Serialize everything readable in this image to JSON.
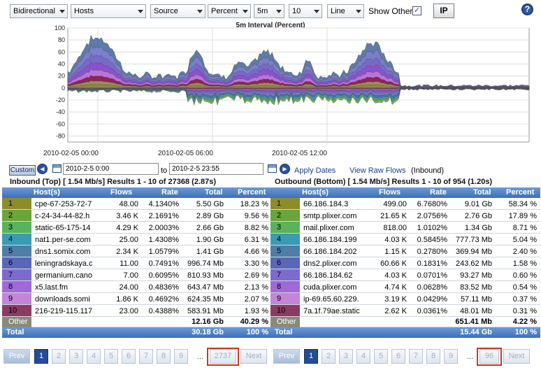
{
  "toolbar": {
    "direction": "Bidirectional",
    "metric": "Hosts",
    "source": "Source",
    "unit": "Percent",
    "interval": "5m",
    "count": "10",
    "chart_style": "Line",
    "show_other_label": "Show Other",
    "show_other_checked": "✓",
    "ip_button": "IP",
    "help": "?"
  },
  "chart_data": {
    "type": "area",
    "title": "5m Interval (Percent)",
    "y_ticks": [
      "100",
      "80",
      "60",
      "40",
      "20",
      "0",
      "-20",
      "-40",
      "-60",
      "-80"
    ],
    "ylim": [
      -90,
      100
    ],
    "x_ticks": [
      "2010-02-05 00:00",
      "2010-02-05 06:00",
      "2010-02-05 12:00"
    ],
    "series_colors": [
      "#8c8c2a",
      "#6aa43a",
      "#3b9bb3",
      "#4e6e9e",
      "#7f7fcf",
      "#7868c8",
      "#8e4fcf",
      "#c078d8",
      "#8b1c4a",
      "#9a9a60"
    ]
  },
  "dates": {
    "custom": "Custom",
    "start": "2010-2-5 0:00",
    "to": "to",
    "end": "2010-2-5 23:55",
    "apply": "Apply Dates",
    "raw": "View Raw Flows",
    "raw_suffix": "(Inbound)"
  },
  "inbound": {
    "header": "Inbound (Top) [ 1.54 Mb/s] Results 1 - 10 of 27368 (2.87s)",
    "columns": [
      "Host(s)",
      "Flows",
      "Rate",
      "Total",
      "Percent"
    ],
    "rows": [
      {
        "n": "1",
        "host": "cpe-67-253-72-7",
        "flows": "48.00",
        "rate": "4.1340%",
        "total": "5.50 Gb",
        "pct": "18.23 %",
        "color": "#8c8c2a"
      },
      {
        "n": "2",
        "host": "c-24-34-44-82.h",
        "flows": "3.46 K",
        "rate": "2.1691%",
        "total": "2.89 Gb",
        "pct": "9.56 %",
        "color": "#6aa43a"
      },
      {
        "n": "3",
        "host": "static-65-175-14",
        "flows": "4.29 K",
        "rate": "2.0003%",
        "total": "2.66 Gb",
        "pct": "8.82 %",
        "color": "#5ab25a"
      },
      {
        "n": "4",
        "host": "nat1.per-se.com",
        "flows": "25.00",
        "rate": "1.4308%",
        "total": "1.90 Gb",
        "pct": "6.31 %",
        "color": "#3b9bb3"
      },
      {
        "n": "5",
        "host": "dns1.somix.com",
        "flows": "2.34 K",
        "rate": "1.0579%",
        "total": "1.41 Gb",
        "pct": "4.66 %",
        "color": "#4e7ea8"
      },
      {
        "n": "6",
        "host": "leningradskaya.c",
        "flows": "11.00",
        "rate": "0.7491%",
        "total": "996.74 Mb",
        "pct": "3.30 %",
        "color": "#5a66b8"
      },
      {
        "n": "7",
        "host": "germanium.cano",
        "flows": "7.00",
        "rate": "0.6095%",
        "total": "810.93 Mb",
        "pct": "2.69 %",
        "color": "#7d6ad0"
      },
      {
        "n": "8",
        "host": "x5.last.fm",
        "flows": "24.00",
        "rate": "0.4836%",
        "total": "643.47 Mb",
        "pct": "2.13 %",
        "color": "#a068d8"
      },
      {
        "n": "9",
        "host": "downloads.somi",
        "flows": "1.86 K",
        "rate": "0.4692%",
        "total": "624.35 Mb",
        "pct": "2.07 %",
        "color": "#c484d8"
      },
      {
        "n": "10",
        "host": "216-219-115.117",
        "flows": "23.00",
        "rate": "0.4388%",
        "total": "583.91 Mb",
        "pct": "1.93 %",
        "color": "#8b3a62"
      }
    ],
    "other": {
      "label": "Other",
      "total": "12.16 Gb",
      "pct": "40.29 %"
    },
    "total": {
      "label": "Total",
      "total": "30.18 Gb",
      "pct": "100 %"
    }
  },
  "outbound": {
    "header": "Outbound (Bottom) [ 1.54 Mb/s] Results 1 - 10 of 954 (1.20s)",
    "columns": [
      "Host(s)",
      "Flows",
      "Rate",
      "Total",
      "Percent"
    ],
    "rows": [
      {
        "n": "1",
        "host": "66.186.184.3",
        "flows": "499.00",
        "rate": "6.7680%",
        "total": "9.01 Gb",
        "pct": "58.34 %",
        "color": "#8c8c2a"
      },
      {
        "n": "2",
        "host": "smtp.plixer.com",
        "flows": "21.65 K",
        "rate": "2.0756%",
        "total": "2.76 Gb",
        "pct": "17.89 %",
        "color": "#6aa43a"
      },
      {
        "n": "3",
        "host": "mail.plixer.com",
        "flows": "818.00",
        "rate": "1.0102%",
        "total": "1.34 Gb",
        "pct": "8.71 %",
        "color": "#5ab25a"
      },
      {
        "n": "4",
        "host": "66.186.184.199",
        "flows": "4.03 K",
        "rate": "0.5845%",
        "total": "777.73 Mb",
        "pct": "5.04 %",
        "color": "#3b9bb3"
      },
      {
        "n": "5",
        "host": "66.186.184.202",
        "flows": "1.15 K",
        "rate": "0.2780%",
        "total": "369.94 Mb",
        "pct": "2.40 %",
        "color": "#4e7ea8"
      },
      {
        "n": "6",
        "host": "dns2.plixer.com",
        "flows": "60.66 K",
        "rate": "0.1831%",
        "total": "243.62 Mb",
        "pct": "1.58 %",
        "color": "#5a66b8"
      },
      {
        "n": "7",
        "host": "66.186.184.62",
        "flows": "4.03 K",
        "rate": "0.0701%",
        "total": "93.27 Mb",
        "pct": "0.60 %",
        "color": "#7d6ad0"
      },
      {
        "n": "8",
        "host": "cuda.plixer.com",
        "flows": "4.74 K",
        "rate": "0.0628%",
        "total": "83.52 Mb",
        "pct": "0.54 %",
        "color": "#a068d8"
      },
      {
        "n": "9",
        "host": "ip-69.65.60.229.",
        "flows": "3.19 K",
        "rate": "0.0429%",
        "total": "57.11 Mb",
        "pct": "0.37 %",
        "color": "#c484d8"
      },
      {
        "n": "10",
        "host": "7a.1f.79ae.static",
        "flows": "2.62 K",
        "rate": "0.0361%",
        "total": "48.01 Mb",
        "pct": "0.31 %",
        "color": "#8b3a62"
      }
    ],
    "other": {
      "label": "Other",
      "total": "651.41 Mb",
      "pct": "4.22 %"
    },
    "total": {
      "label": "Total",
      "total": "15.44 Gb",
      "pct": "100 %"
    }
  },
  "pager_left": {
    "prev": "Prev",
    "pages": [
      "1",
      "2",
      "3",
      "4",
      "5",
      "6",
      "7",
      "8",
      "9"
    ],
    "dots": "...",
    "last": "2737",
    "next": "Next"
  },
  "pager_right": {
    "prev": "Prev",
    "pages": [
      "1",
      "2",
      "3",
      "4",
      "5",
      "6",
      "7",
      "8",
      "9"
    ],
    "dots": "...",
    "last": "96",
    "next": "Next"
  }
}
